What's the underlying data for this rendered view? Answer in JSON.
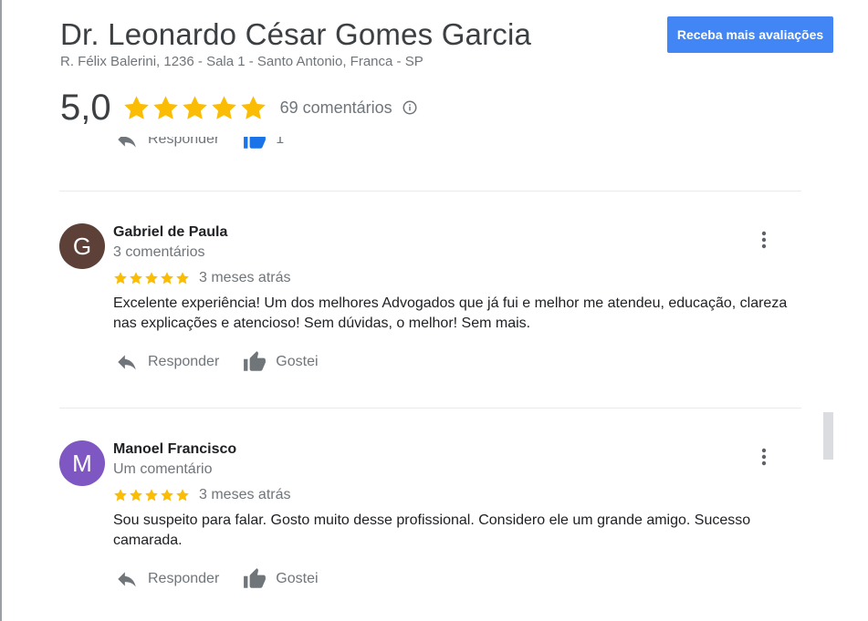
{
  "header": {
    "title": "Dr. Leonardo César Gomes Garcia",
    "address": "R. Félix Balerini, 1236 - Sala 1 - Santo Antonio, Franca - SP",
    "cta_label": "Receba mais avaliações",
    "score": "5,0",
    "star_rating": 5,
    "reviews_count": "69 comentários"
  },
  "partial_review": {
    "reply_label": "Responder",
    "like_count": "1"
  },
  "reviews": [
    {
      "avatar_letter": "G",
      "avatar_color": "#5d4037",
      "name": "Gabriel de Paula",
      "comment_count": "3 comentários",
      "rating": 5,
      "time": "3 meses atrás",
      "text": "Excelente experiência! Um dos melhores Advogados que já fui e melhor me atendeu, educação, clareza nas explicações e atencioso! Sem dúvidas, o melhor! Sem mais.",
      "reply_label": "Responder",
      "like_label": "Gostei"
    },
    {
      "avatar_letter": "M",
      "avatar_color": "#7e57c2",
      "name": "Manoel Francisco",
      "comment_count": "Um comentário",
      "rating": 5,
      "time": "3 meses atrás",
      "text": "Sou suspeito para falar. Gosto muito desse profissional. Considero ele um grande amigo. Sucesso camarada.",
      "reply_label": "Responder",
      "like_label": "Gostei"
    }
  ],
  "colors": {
    "star": "#fbbc04",
    "accent": "#4285f4",
    "icon_gray": "#70757a"
  }
}
